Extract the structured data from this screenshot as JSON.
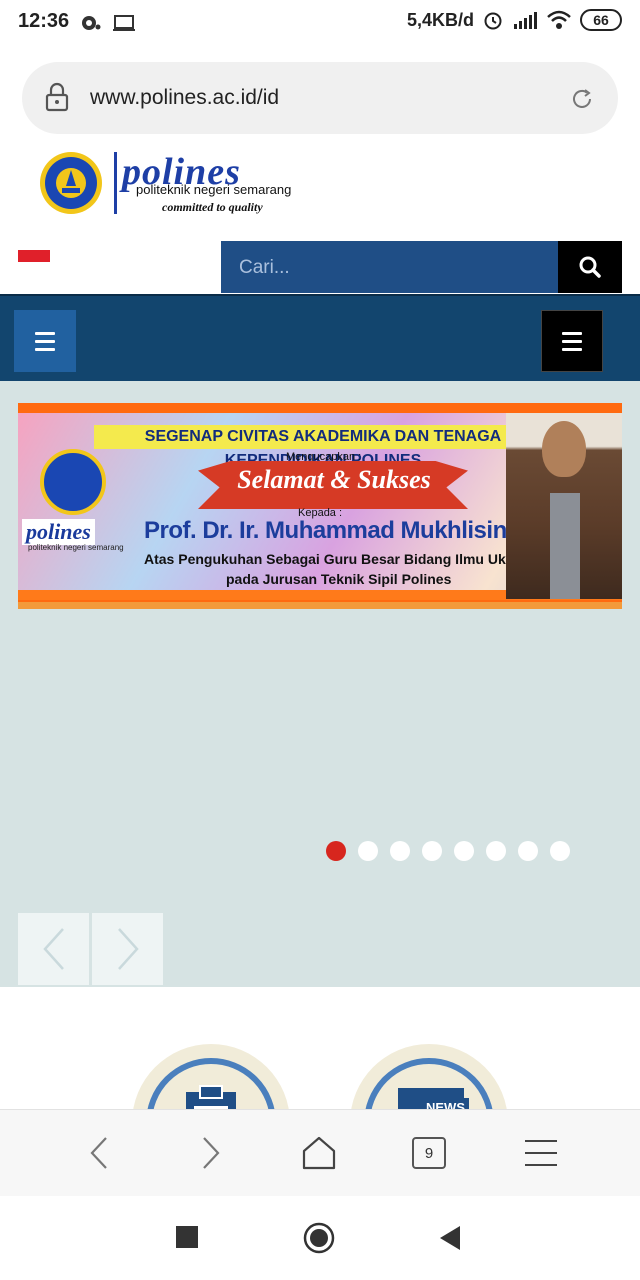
{
  "status_bar": {
    "time": "12:36",
    "speed": "5,4KB/d",
    "battery": "66"
  },
  "browser": {
    "url": "www.polines.ac.id/id",
    "tab_count": "9"
  },
  "site": {
    "brand_name": "polines",
    "brand_subtitle": "politeknik negeri semarang",
    "brand_tagline": "committed to quality",
    "search_placeholder": "Cari..."
  },
  "banner": {
    "headline": "SEGENAP CIVITAS AKADEMIKA DAN TENAGA KEPENDIDIKAN POLINES",
    "mengucapkan": "Mengucapkan :",
    "greeting": "Selamat & Sukses",
    "kepada": "Kepada :",
    "name": "Prof. Dr. Ir. Muhammad Mukhlisin, MT",
    "line1": "Atas Pengukuhan Sebagai Guru Besar Bidang Ilmu Ukur Tanah",
    "line2": "pada Jurusan Teknik Sipil Polines",
    "brand": "polines",
    "brand_sub": "politeknik negeri semarang"
  },
  "slider": {
    "total_slides": 8,
    "active_slide": 1
  },
  "features": {
    "news_label": "NEWS"
  },
  "colors": {
    "nav": "#12456e",
    "search": "#1f4e86",
    "slider_bg": "#d6e3e3",
    "active_dot": "#d7261e",
    "banner_orange": "#ff6a10"
  }
}
